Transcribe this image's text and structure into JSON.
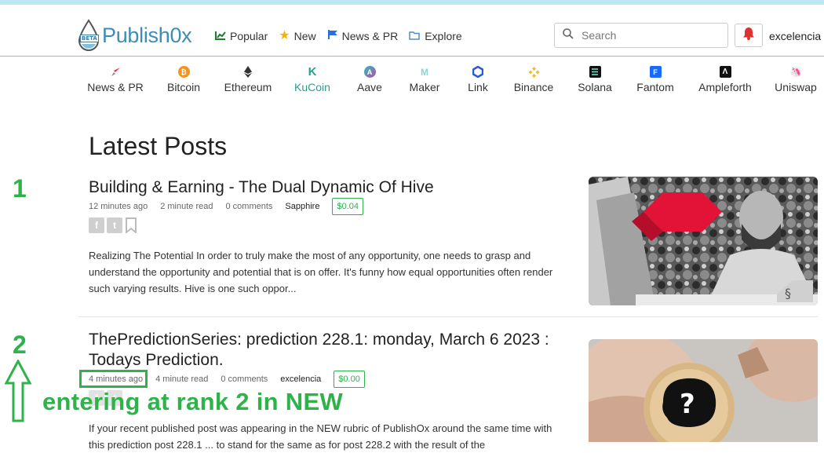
{
  "brand": {
    "name": "Publish0x",
    "badge": "BETA"
  },
  "nav": [
    {
      "label": "Popular",
      "icon": "chart-icon"
    },
    {
      "label": "New",
      "icon": "star-icon"
    },
    {
      "label": "News & PR",
      "icon": "flag-icon"
    },
    {
      "label": "Explore",
      "icon": "folder-icon"
    }
  ],
  "search": {
    "placeholder": "Search"
  },
  "user": {
    "name": "excelencia"
  },
  "topics": [
    {
      "label": "News & PR",
      "color": "#e0353a"
    },
    {
      "label": "Bitcoin",
      "color": "#f7931a"
    },
    {
      "label": "Ethereum",
      "color": "#333333"
    },
    {
      "label": "KuCoin",
      "color": "#25a18e"
    },
    {
      "label": "Aave",
      "color": "#9b6fd8"
    },
    {
      "label": "Maker",
      "color": "#8fd6cf"
    },
    {
      "label": "Link",
      "color": "#2a5ada"
    },
    {
      "label": "Binance",
      "color": "#f3ba2f"
    },
    {
      "label": "Solana",
      "color": "#111111"
    },
    {
      "label": "Fantom",
      "color": "#1969ff"
    },
    {
      "label": "Ampleforth",
      "color": "#111111"
    },
    {
      "label": "Uniswap",
      "color": "#ff007a"
    }
  ],
  "active_topic": "KuCoin",
  "heading": "Latest Posts",
  "posts": [
    {
      "rank": "1",
      "title": "Building & Earning - The Dual Dynamic Of Hive",
      "time": "12 minutes ago",
      "read": "2 minute read",
      "comments": "0 comments",
      "author": "Sapphire",
      "earnings": "$0.04",
      "excerpt": "Realizing The Potential In order to truly make the most of any opportunity, one needs to grasp and understand the opportunity and potential that is on offer. It's funny how equal opportunities often render such varying results. Hive is one such oppor..."
    },
    {
      "rank": "2",
      "title": "ThePredictionSeries: prediction 228.1: monday, March 6 2023 : Todays Prediction.",
      "time": "4 minutes ago",
      "read": "4 minute read",
      "comments": "0 comments",
      "author": "excelencia",
      "earnings": "$0.00",
      "excerpt": "If your recent published post was appearing in the NEW rubric of PublishOx around the same time with this prediction post 228.1 ... to stand for the same as for post 228.2 with the result of the"
    }
  ],
  "annotation": "entering at rank 2 in NEW",
  "colors": {
    "accent": "#2db34a",
    "brand": "#3e8db5",
    "hive_red": "#e31337"
  }
}
